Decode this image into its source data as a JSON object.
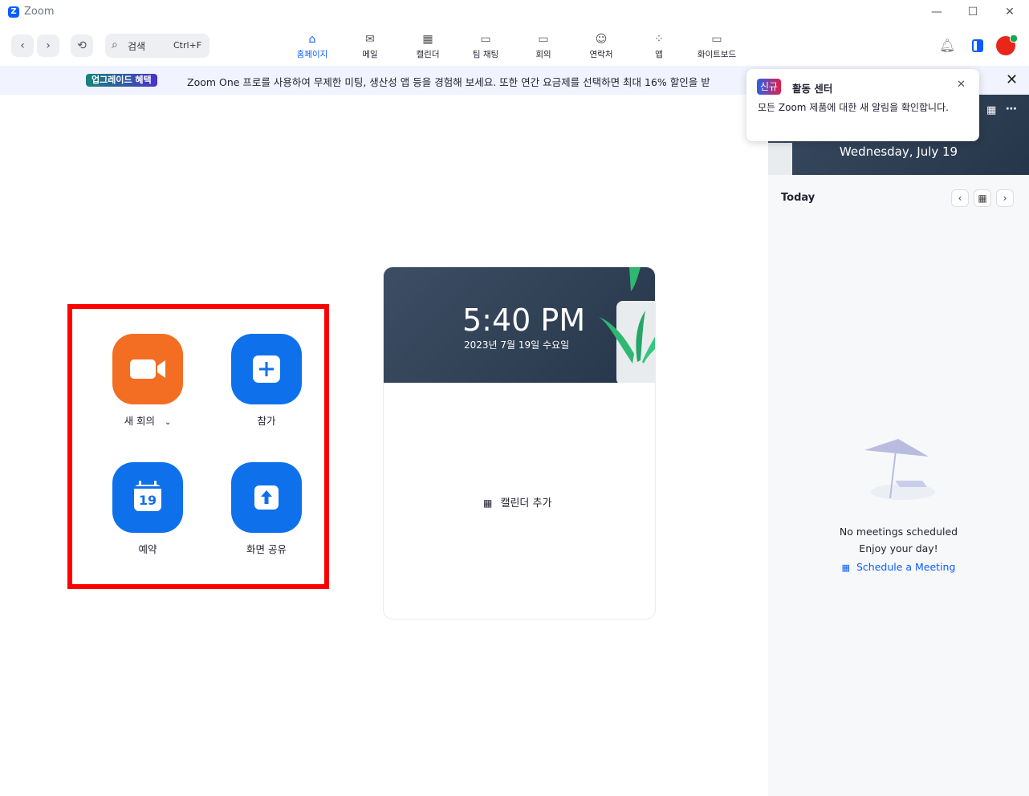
{
  "app": {
    "title": "Zoom",
    "logo_letter": "Z"
  },
  "toolbar": {
    "search_placeholder": "검색",
    "search_shortcut": "Ctrl+F",
    "tabs": [
      {
        "label": "홈페이지",
        "icon": "home-icon",
        "active": true
      },
      {
        "label": "메일",
        "icon": "mail-icon",
        "active": false
      },
      {
        "label": "캘린더",
        "icon": "calendar-icon",
        "active": false
      },
      {
        "label": "팀 채팅",
        "icon": "chat-icon",
        "active": false
      },
      {
        "label": "회의",
        "icon": "video-icon",
        "active": false
      },
      {
        "label": "연락처",
        "icon": "contacts-icon",
        "active": false
      },
      {
        "label": "앱",
        "icon": "apps-icon",
        "active": false
      },
      {
        "label": "화이트보드",
        "icon": "whiteboard-icon",
        "active": false
      }
    ]
  },
  "banner": {
    "badge": "업그레이드 혜택",
    "text": "Zoom One 프로를 사용하여 무제한 미팅, 생산성 앱 등을 경험해 보세요. 또한 연간 요금제를 선택하면 최대 16% 할인을 받"
  },
  "actions": {
    "new_meeting": "새 회의",
    "join": "참가",
    "schedule": "예약",
    "schedule_day": "19",
    "share_screen": "화면 공유"
  },
  "clock": {
    "time": "5:40 PM",
    "date": "2023년 7월 19일 수요일",
    "add_calendar": "캘린더 추가"
  },
  "right_panel": {
    "date": "Wednesday, July 19",
    "today": "Today",
    "no_meetings": "No meetings scheduled",
    "enjoy": "Enjoy your day!",
    "schedule_link": "Schedule a Meeting"
  },
  "popup": {
    "badge": "신규",
    "title": "활동 센터",
    "body": "모든 Zoom 제품에 대한 새 알림을 확인합니다."
  },
  "colors": {
    "accent": "#0b5cff",
    "orange": "#f36e22",
    "highlight": "#ff0000"
  }
}
